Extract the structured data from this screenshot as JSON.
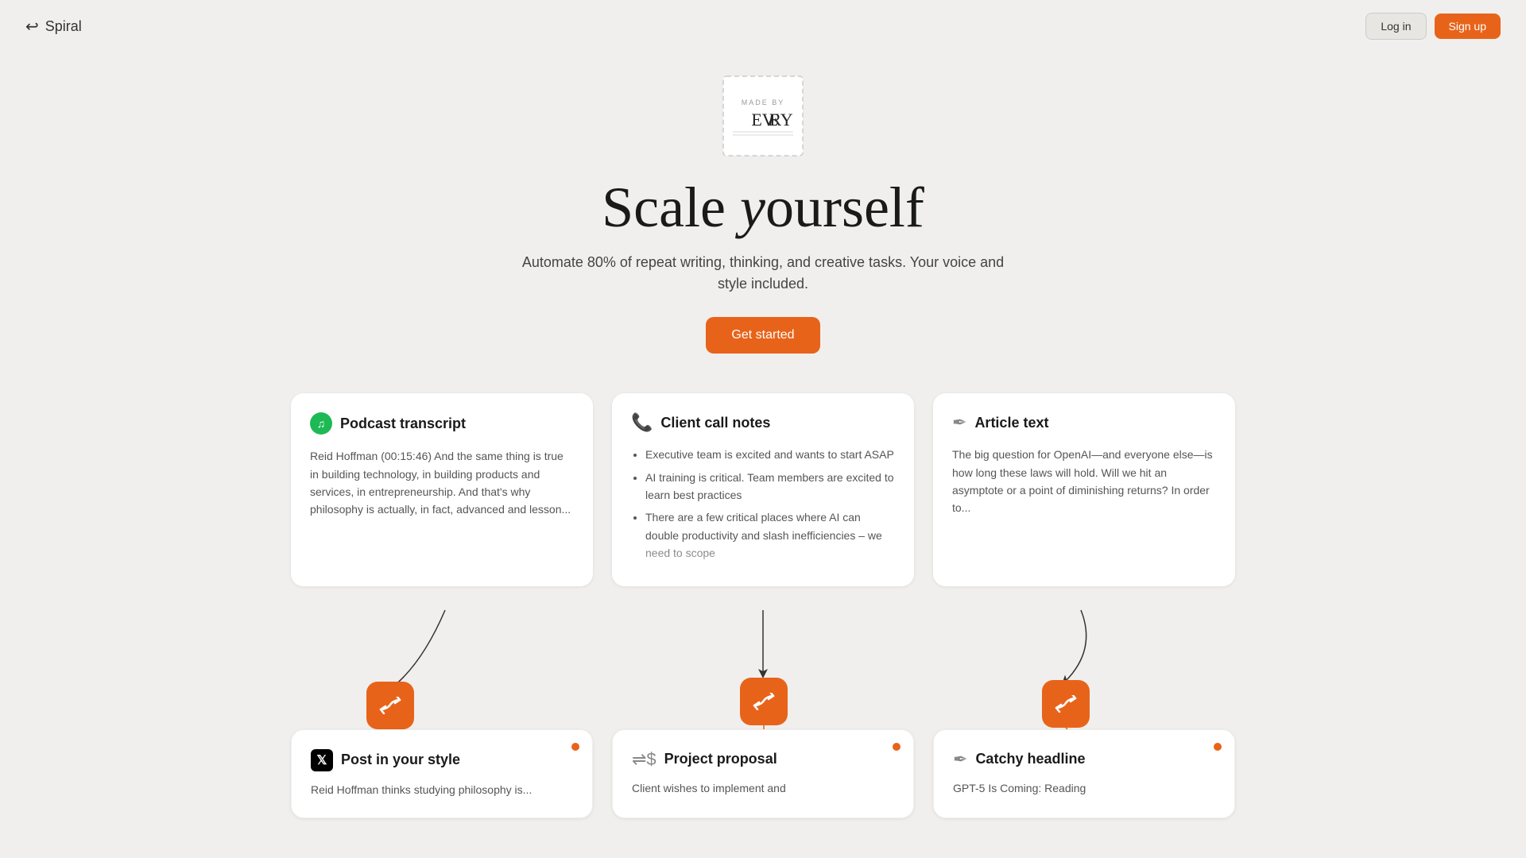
{
  "app": {
    "logo_arrow": "↩",
    "logo_text": "Spiral"
  },
  "header": {
    "login_label": "Log in",
    "signup_label": "Sign up"
  },
  "stamp": {
    "line1": "MADE BY",
    "line2": "EVERY"
  },
  "hero": {
    "title_part1": "Scale ",
    "title_italic": "y",
    "title_part2": "ourself",
    "subtitle": "Automate 80% of repeat writing, thinking, and creative tasks. Your voice and style included.",
    "cta_label": "Get started"
  },
  "input_cards": [
    {
      "id": "podcast",
      "title": "Podcast transcript",
      "icon_type": "spotify",
      "content": "Reid Hoffman (00:15:46) And the same thing is true in building technology, in building products and services, in entrepreneurship. And that's why philosophy is actually, in fact, advanced and lesson..."
    },
    {
      "id": "client-call",
      "title": "Client call notes",
      "icon_type": "phone",
      "items": [
        "Executive team is excited and wants to start ASAP",
        "AI training is critical. Team members are excited to learn best practices",
        "There are a few critical places where AI can double productivity and slash inefficiencies – we need to scope"
      ]
    },
    {
      "id": "article",
      "title": "Article text",
      "icon_type": "quill",
      "content": "The big question for OpenAI—and everyone else—is how long these laws will hold. Will we hit an asymptote or a point of diminishing returns? In order to..."
    }
  ],
  "output_cards": [
    {
      "id": "post",
      "title": "Post in your style",
      "icon_type": "x",
      "content": "Reid Hoffman thinks studying philosophy is..."
    },
    {
      "id": "proposal",
      "title": "Project proposal",
      "icon_type": "dollar",
      "content": "Client wishes to implement and"
    },
    {
      "id": "headline",
      "title": "Catchy headline",
      "icon_type": "article",
      "content": "GPT-5 Is Coming:  Reading"
    }
  ],
  "spiral_icon": "↩"
}
